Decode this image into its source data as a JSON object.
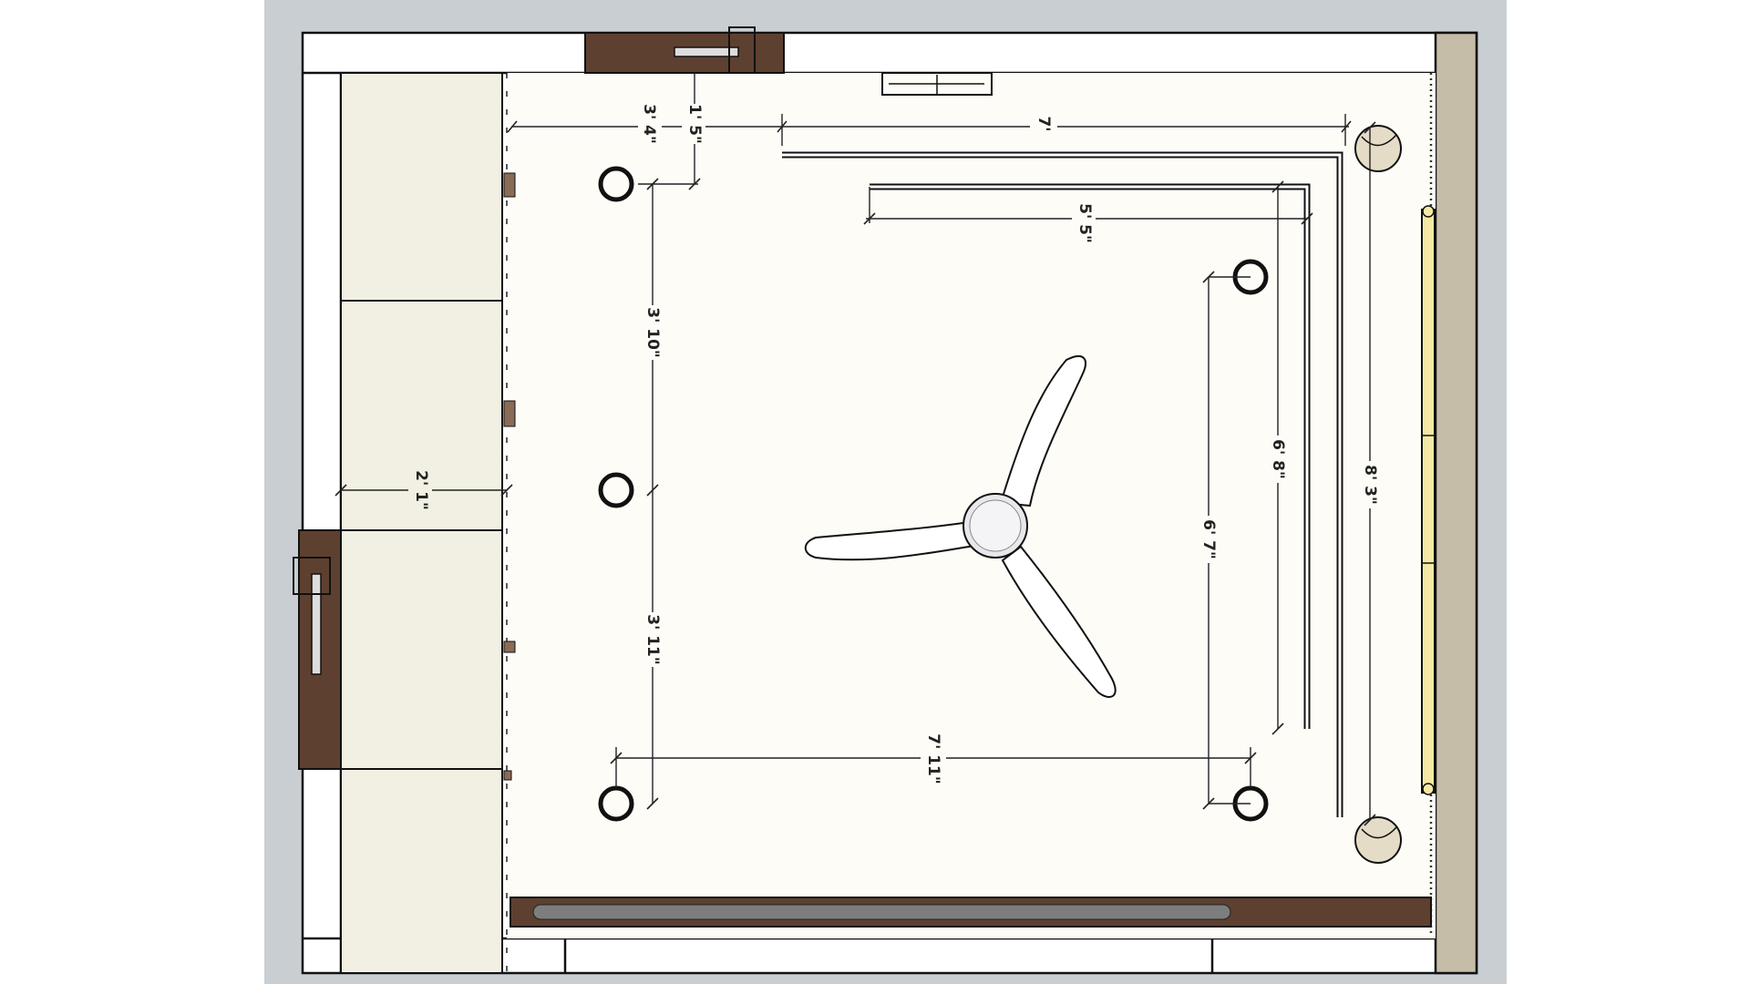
{
  "plan": {
    "title": "",
    "dimensions": {
      "top_band_width": "7'",
      "inner_band_width": "5' 5\"",
      "left_offset": "3' 4\"",
      "top_offset": "1' 5\"",
      "light_spacing_upper": "3' 10\"",
      "light_spacing_lower": "3' 11\"",
      "wardrobe_depth": "2' 1\"",
      "light_span_horizontal": "7' 11\"",
      "right_light_vertical": "6' 7\"",
      "inner_band_height": "6' 8\"",
      "outer_band_height": "8' 3\""
    },
    "colors": {
      "background": "#c8ced2",
      "floor": "#fdfcf7",
      "wardrobe": "#f1f0e2",
      "wood": "#5e4030",
      "curtain_rail": "#f3e9a4",
      "side_wall": "#c6bda9"
    },
    "fixtures": [
      "ceiling-fan",
      "downlight",
      "wall-sconce",
      "wardrobe",
      "door",
      "window",
      "ac-unit",
      "cove-lighting-profile",
      "curtain-rail"
    ]
  }
}
